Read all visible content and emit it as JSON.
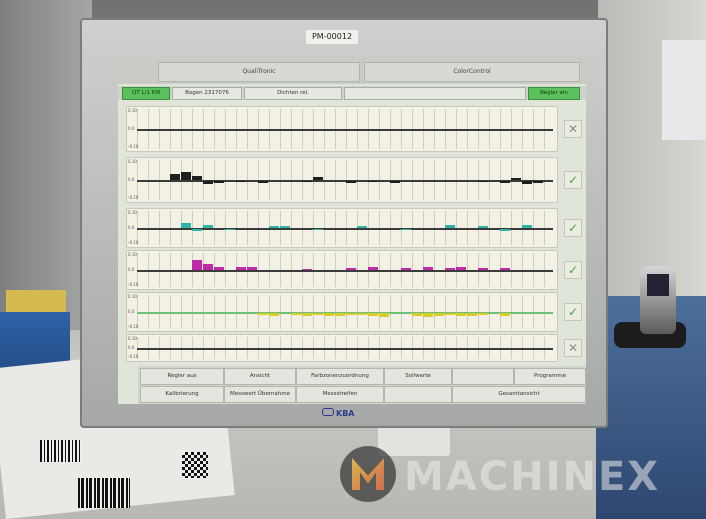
{
  "monitor": {
    "asset_tag": "PM-00012",
    "brand": "KBA"
  },
  "screen": {
    "tabs": [
      "QualiTronic",
      "ColorControl"
    ],
    "toolbar": {
      "status_left": "QT  L/1  KM",
      "sheet": "Bogen 2317076",
      "mode": "Dichten rel.",
      "right_button": "Regler ein"
    },
    "panels": [
      {
        "scale_top": "0.10",
        "scale_mid": "0.0",
        "scale_bottom": "-0.10",
        "color": "#3b3b3b",
        "status": "close-icon"
      },
      {
        "scale_top": "0.10",
        "scale_mid": "0.0",
        "scale_bottom": "-0.10",
        "color": "#1f1f1f",
        "status": "check-icon"
      },
      {
        "scale_top": "0.10",
        "scale_mid": "0.0",
        "scale_bottom": "-0.10",
        "color": "#2fb5a8",
        "status": "check-icon"
      },
      {
        "scale_top": "0.10",
        "scale_mid": "0.0",
        "scale_bottom": "-0.10",
        "color": "#c02aa8",
        "status": "check-icon"
      },
      {
        "scale_top": "0.10",
        "scale_mid": "0.0",
        "scale_bottom": "-0.10",
        "color": "#d6cc2b",
        "status": "check-icon"
      },
      {
        "scale_top": "0.10",
        "scale_mid": "0.0",
        "scale_bottom": "-0.10",
        "color": "#3b3b3b",
        "status": "close-icon"
      }
    ],
    "bottom_buttons": [
      "Regler aus",
      "Ansicht",
      "Farbzonenzuordnung",
      "Sollwerte",
      "",
      "Programme",
      "Kalibrierung",
      "Messwert Übernahme",
      "Messstreifen",
      "",
      "Gesamtansicht"
    ]
  },
  "watermark": {
    "text": "MACHINEX"
  }
}
